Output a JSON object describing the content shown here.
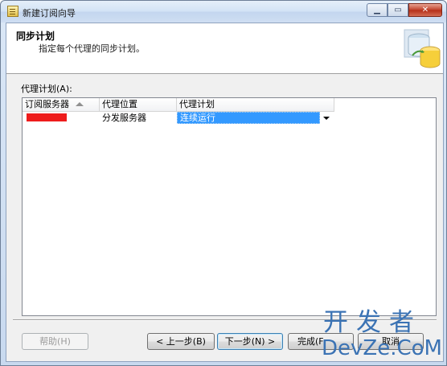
{
  "window": {
    "title": "新建订阅向导"
  },
  "header": {
    "title": "同步计划",
    "subtitle": "指定每个代理的同步计划。"
  },
  "grid": {
    "label": "代理计划(A):",
    "columns": [
      "订阅服务器",
      "代理位置",
      "代理计划"
    ],
    "rows": [
      {
        "subscriber": "",
        "location": "分发服务器",
        "schedule": "连续运行"
      }
    ]
  },
  "buttons": {
    "help": "帮助(H)",
    "back": "< 上一步(B)",
    "next": "下一步(N) >",
    "finish": "完成(F",
    "cancel": "取消"
  },
  "watermark": {
    "line1": "开发者",
    "line2": "DevZe.CoM"
  },
  "colors": {
    "selection": "#3399ff",
    "redaction": "#ee1c1c",
    "watermark": "#3b73b4"
  }
}
